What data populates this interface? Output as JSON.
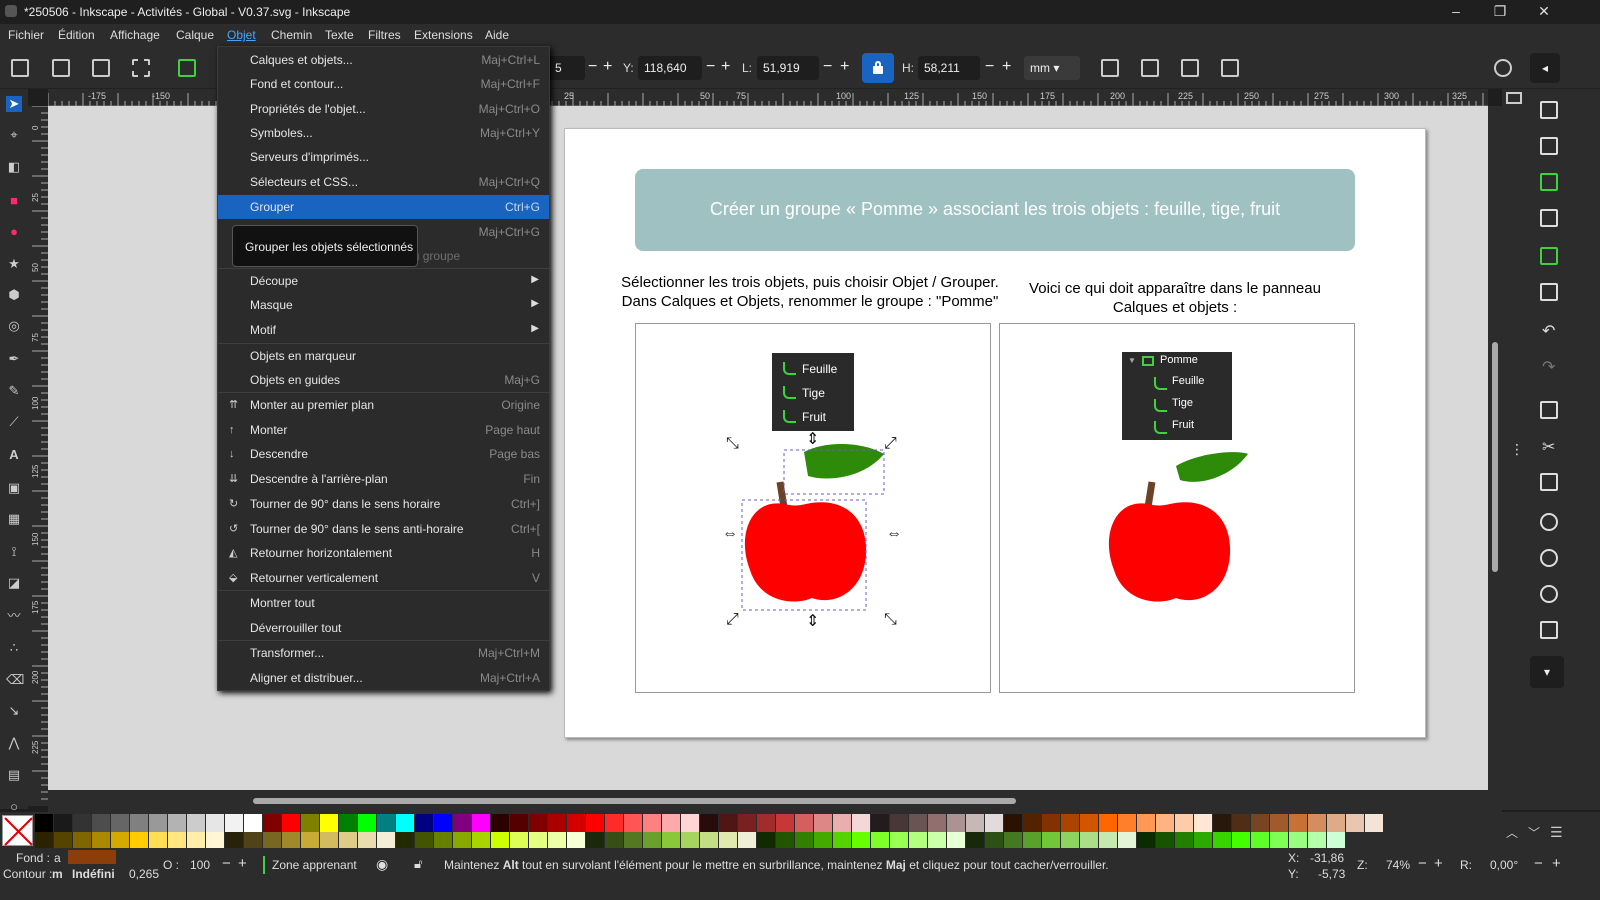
{
  "window": {
    "title": "*250506 - Inkscape - Activités - Global - V0.37.svg - Inkscape",
    "minimize": "–",
    "maximize": "❐",
    "close": "✕"
  },
  "menubar": [
    "Fichier",
    "Édition",
    "Affichage",
    "Calque",
    "Objet",
    "Chemin",
    "Texte",
    "Filtres",
    "Extensions",
    "Aide"
  ],
  "toolbar": {
    "x_partial": "5",
    "y_label": "Y:",
    "y_value": "118,640",
    "w_label": "L:",
    "w_value": "51,919",
    "h_label": "H:",
    "h_value": "58,211",
    "unit": "mm"
  },
  "hruler_ticks": [
    "-175",
    "-150",
    "25",
    "50",
    "75",
    "100",
    "125",
    "150",
    "175",
    "200",
    "225",
    "250",
    "275",
    "300",
    "325"
  ],
  "vruler_ticks": [
    "0",
    "25",
    "50",
    "75",
    "100",
    "125",
    "150",
    "175",
    "200",
    "225"
  ],
  "object_menu": {
    "items": [
      {
        "label": "Calques et objets...",
        "shortcut": "Maj+Ctrl+L"
      },
      {
        "label": "Fond et contour...",
        "shortcut": "Maj+Ctrl+F"
      },
      {
        "label": "Propriétés de l'objet...",
        "shortcut": "Maj+Ctrl+O"
      },
      {
        "label": "Symboles...",
        "shortcut": "Maj+Ctrl+Y"
      },
      {
        "label": "Serveurs d'imprimés...",
        "shortcut": ""
      },
      {
        "label": "Sélecteurs et CSS...",
        "shortcut": "Maj+Ctrl+Q"
      },
      {
        "label": "Grouper",
        "shortcut": "Ctrl+G"
      },
      {
        "label": "Dégrouper",
        "shortcut": "Maj+Ctrl+G"
      },
      {
        "label": "Sortir les objets sélectionnés du groupe",
        "shortcut": ""
      },
      {
        "label": "Découpe",
        "shortcut": ""
      },
      {
        "label": "Masque",
        "shortcut": ""
      },
      {
        "label": "Motif",
        "shortcut": ""
      },
      {
        "label": "Objets en marqueur",
        "shortcut": ""
      },
      {
        "label": "Objets en guides",
        "shortcut": "Maj+G"
      },
      {
        "label": "Monter au premier plan",
        "shortcut": "Origine"
      },
      {
        "label": "Monter",
        "shortcut": "Page haut"
      },
      {
        "label": "Descendre",
        "shortcut": "Page bas"
      },
      {
        "label": "Descendre à l'arrière-plan",
        "shortcut": "Fin"
      },
      {
        "label": "Tourner de 90° dans le sens horaire",
        "shortcut": "Ctrl+]"
      },
      {
        "label": "Tourner de 90° dans le sens anti-horaire",
        "shortcut": "Ctrl+["
      },
      {
        "label": "Retourner horizontalement",
        "shortcut": "H"
      },
      {
        "label": "Retourner verticalement",
        "shortcut": "V"
      },
      {
        "label": "Montrer tout",
        "shortcut": ""
      },
      {
        "label": "Déverrouiller tout",
        "shortcut": ""
      },
      {
        "label": "Transformer...",
        "shortcut": "Maj+Ctrl+M"
      },
      {
        "label": "Aligner et distribuer...",
        "shortcut": "Maj+Ctrl+A"
      }
    ],
    "submenu_arrow": "▶",
    "tooltip": "Grouper les objets sélectionnés"
  },
  "document": {
    "banner": "Créer un groupe « Pomme » associant les trois objets : feuille, tige, fruit",
    "instruction_left": [
      "Sélectionner les trois objets, puis choisir Objet / Grouper.",
      "Dans Calques et Objets, renommer le groupe : \"Pomme\""
    ],
    "instruction_right": [
      "Voici ce qui doit apparaître dans le panneau",
      "Calques et objets :"
    ],
    "left_layers": [
      "Feuille",
      "Tige",
      "Fruit"
    ],
    "right_group": "Pomme",
    "right_layers": [
      "Feuille",
      "Tige",
      "Fruit"
    ],
    "colors": {
      "apple": "#ff0000",
      "leaf": "#2e8b0a",
      "stem": "#6b4226",
      "banner": "#9fc1c2"
    }
  },
  "status": {
    "fill_label": "Fond :",
    "fill_value": "a",
    "stroke_label": "Contour :",
    "stroke_value": "m",
    "stroke_paint": "Indéfini",
    "stroke_width": "0,265",
    "opacity_label": "O :",
    "opacity_value": "100",
    "layer": "Zone apprenant",
    "hint_1": "Maintenez ",
    "hint_alt": "Alt",
    "hint_2": " tout en survolant l'élément pour le mettre en surbrillance, maintenez ",
    "hint_maj": "Maj",
    "hint_3": " et cliquez pour tout cacher/verrouiller.",
    "x_label": "X:",
    "x_value": "-31,86",
    "y_label": "Y:",
    "y_value": "-5,73",
    "zoom_label": "Z:",
    "zoom_value": "74%",
    "rot_label": "R:",
    "rot_value": "0,00°",
    "fill_color": "#8b3d0a"
  }
}
